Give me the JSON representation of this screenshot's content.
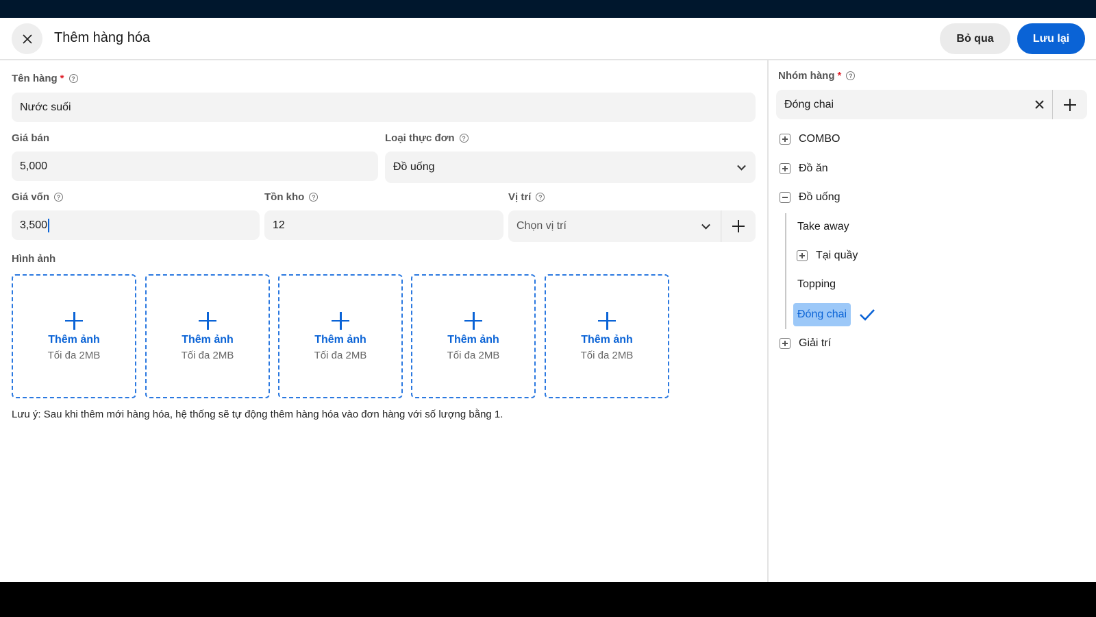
{
  "header": {
    "title": "Thêm hàng hóa",
    "skip_label": "Bỏ qua",
    "save_label": "Lưu lại"
  },
  "form": {
    "name": {
      "label": "Tên hàng",
      "required": "*",
      "value": "Nước suối"
    },
    "price": {
      "label": "Giá bán",
      "value": "5,000"
    },
    "menu_type": {
      "label": "Loại thực đơn",
      "value": "Đồ uống"
    },
    "cost": {
      "label": "Giá vốn",
      "value": "3,500"
    },
    "stock": {
      "label": "Tồn kho",
      "value": "12"
    },
    "location": {
      "label": "Vị trí",
      "placeholder": "Chọn vị trí"
    },
    "images": {
      "label": "Hình ảnh",
      "slots": [
        {
          "title": "Thêm ảnh",
          "sub": "Tối đa 2MB"
        },
        {
          "title": "Thêm ảnh",
          "sub": "Tối đa 2MB"
        },
        {
          "title": "Thêm ảnh",
          "sub": "Tối đa 2MB"
        },
        {
          "title": "Thêm ảnh",
          "sub": "Tối đa 2MB"
        },
        {
          "title": "Thêm ảnh",
          "sub": "Tối đa 2MB"
        }
      ]
    },
    "note": "Lưu ý: Sau khi thêm mới hàng hóa, hệ thống sẽ tự động thêm hàng hóa vào đơn hàng với số lượng bằng 1."
  },
  "group": {
    "label": "Nhóm hàng",
    "required": "*",
    "value": "Đóng chai",
    "tree": [
      "COMBO",
      "Đồ ăn",
      "Đồ uống",
      "Take away",
      "Tại quầy",
      "Topping",
      "Đóng chai",
      "Giải trí"
    ]
  },
  "colors": {
    "accent": "#0a63d6",
    "selected_bg": "#9cc8f8",
    "topbar": "#00172d"
  }
}
